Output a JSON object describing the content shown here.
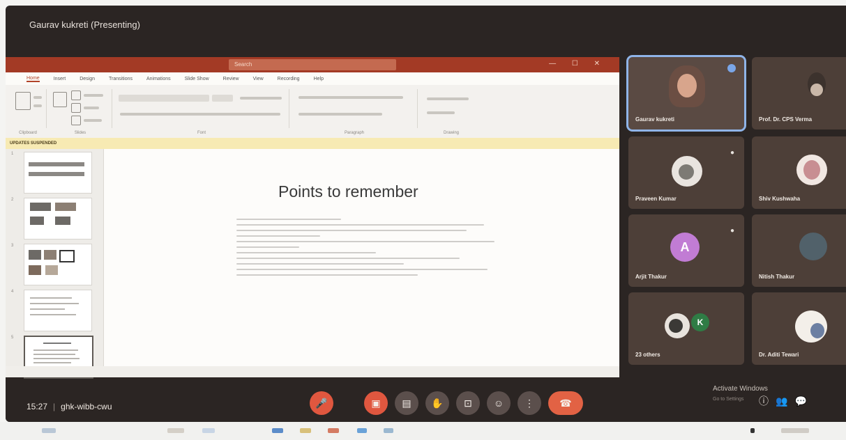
{
  "meet": {
    "presenter_title": "Gaurav kukreti (Presenting)",
    "time": "15:27",
    "separator": "|",
    "meeting_code": "ghk-wibb-cwu",
    "controls": [
      "mic-icon",
      "camera-icon",
      "captions-icon",
      "raise-hand-icon",
      "present-icon",
      "emoji-icon",
      "more-icon",
      "end-call-icon"
    ],
    "activate_windows": "Activate Windows",
    "activate_sub": "Go to Settings",
    "participants": [
      {
        "name": "Gaurav kukreti",
        "avatar": "photo",
        "speaking": true
      },
      {
        "name": "Prof. Dr. CPS Verma",
        "avatar": "photo"
      },
      {
        "name": "Praveen Kumar",
        "avatar": "photo"
      },
      {
        "name": "Shiv Kushwaha",
        "avatar": "photo"
      },
      {
        "name": "Arjit Thakur",
        "avatar": "letter",
        "letter": "A"
      },
      {
        "name": "Nitish Thakur",
        "avatar": "photo"
      },
      {
        "name": "23 others",
        "avatar": "group",
        "letter": "K"
      },
      {
        "name": "Dr. Aditi Tewari",
        "avatar": "photo"
      }
    ]
  },
  "powerpoint": {
    "search_placeholder": "Search",
    "ribbon_tabs": [
      "Home",
      "Insert",
      "Design",
      "Transitions",
      "Animations",
      "Slide Show",
      "Review",
      "View",
      "Recording",
      "Help"
    ],
    "ribbon_groups": [
      "Clipboard",
      "Slides",
      "Font",
      "Paragraph",
      "Drawing"
    ],
    "notice_bold": "UPDATES SUSPENDED",
    "slide_title": "Points to remember",
    "slide_numbers": [
      "1",
      "2",
      "3",
      "4",
      "5"
    ]
  },
  "colors": {
    "ppt_accent": "#a33a25",
    "meet_background": "#2b2523",
    "end_call": "#e26244",
    "speaking_outline": "#8fb4e8"
  }
}
